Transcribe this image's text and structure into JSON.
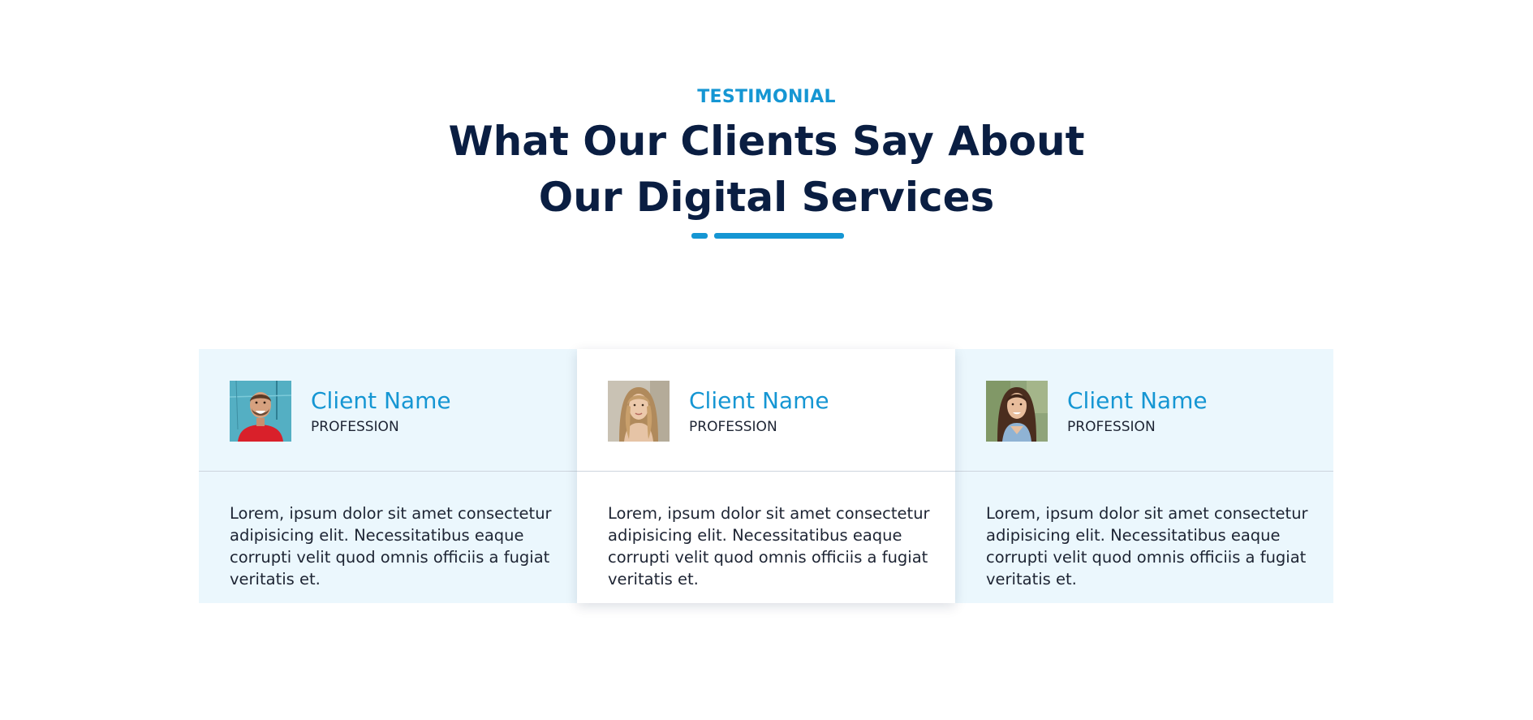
{
  "section": {
    "eyebrow": "TESTIMONIAL",
    "title_line_1": "What Our Clients Say About",
    "title_line_2": "Our Digital Services"
  },
  "colors": {
    "accent": "#1596d3",
    "heading": "#0a1e42",
    "text": "#1d2433",
    "card_tint": "#ebf7fd",
    "card_active": "#ffffff"
  },
  "testimonials": [
    {
      "avatar_icon": "avatar-photo-man-red-shirt",
      "name": "Client Name",
      "profession": "PROFESSION",
      "quote": "Lorem, ipsum dolor sit amet consectetur adipisicing elit. Necessitatibus eaque corrupti velit quod omnis officiis a fugiat veritatis et."
    },
    {
      "avatar_icon": "avatar-photo-woman-blonde",
      "name": "Client Name",
      "profession": "PROFESSION",
      "quote": "Lorem, ipsum dolor sit amet consectetur adipisicing elit. Necessitatibus eaque corrupti velit quod omnis officiis a fugiat veritatis et."
    },
    {
      "avatar_icon": "avatar-photo-woman-brunette",
      "name": "Client Name",
      "profession": "PROFESSION",
      "quote": "Lorem, ipsum dolor sit amet consectetur adipisicing elit. Necessitatibus eaque corrupti velit quod omnis officiis a fugiat veritatis et."
    }
  ]
}
